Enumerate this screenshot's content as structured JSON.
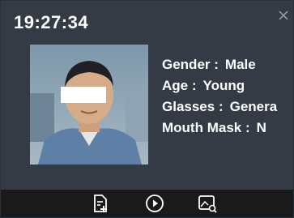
{
  "header": {
    "time": "19:27:34",
    "close_icon": "close-icon"
  },
  "face": {
    "snapshot_icon": "face-photo"
  },
  "attributes": [
    {
      "label": "Gender :",
      "value": "Male"
    },
    {
      "label": "Age :",
      "value": "Young"
    },
    {
      "label": "Glasses :",
      "value": "Genera"
    },
    {
      "label": "Mouth Mask :",
      "value": "N"
    }
  ],
  "toolbar": {
    "buttons": [
      "add-file-icon",
      "play-icon",
      "image-search-icon"
    ]
  },
  "colors": {
    "panel_bg": "#343b44",
    "toolbar_bg": "#1a1a1a",
    "text": "#ffffff"
  }
}
